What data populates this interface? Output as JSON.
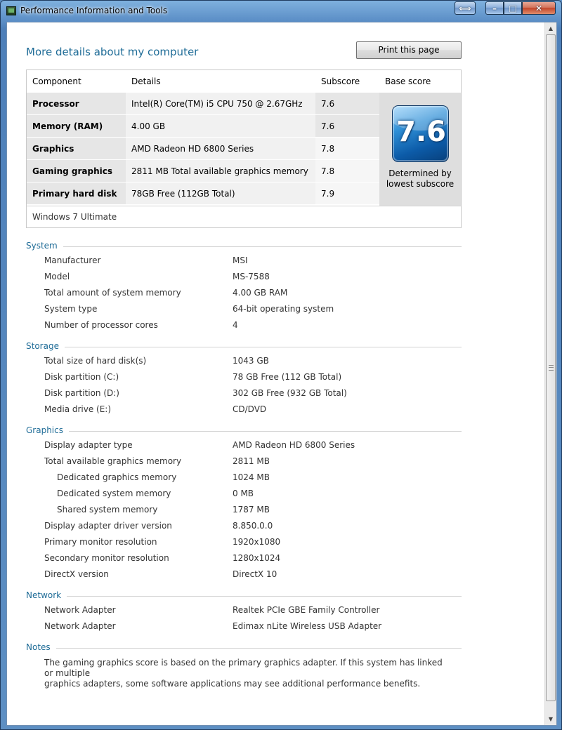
{
  "window": {
    "title": "Performance Information and Tools",
    "controls": {
      "resize": "⟺",
      "minimize": "–",
      "maximize": "□",
      "close": "✕"
    }
  },
  "page": {
    "title": "More details about my computer",
    "print_button": "Print this page"
  },
  "score_table": {
    "headers": [
      "Component",
      "Details",
      "Subscore",
      "Base score"
    ],
    "rows": [
      {
        "component": "Processor",
        "details": "Intel(R) Core(TM) i5 CPU 750 @ 2.67GHz",
        "subscore": "7.6"
      },
      {
        "component": "Memory (RAM)",
        "details": "4.00 GB",
        "subscore": "7.6"
      },
      {
        "component": "Graphics",
        "details": "AMD Radeon HD 6800 Series",
        "subscore": "7.8"
      },
      {
        "component": "Gaming graphics",
        "details": "2811 MB Total available graphics memory",
        "subscore": "7.8"
      },
      {
        "component": "Primary hard disk",
        "details": "78GB Free (112GB Total)",
        "subscore": "7.9"
      }
    ],
    "base_score": "7.6",
    "base_caption_line1": "Determined by",
    "base_caption_line2": "lowest subscore",
    "footer": "Windows 7 Ultimate"
  },
  "system": {
    "title": "System",
    "items": [
      {
        "key": "Manufacturer",
        "value": "MSI"
      },
      {
        "key": "Model",
        "value": "MS-7588"
      },
      {
        "key": "Total amount of system memory",
        "value": "4.00 GB RAM"
      },
      {
        "key": "System type",
        "value": "64-bit operating system"
      },
      {
        "key": "Number of processor cores",
        "value": "4"
      }
    ]
  },
  "storage": {
    "title": "Storage",
    "items": [
      {
        "key": "Total size of hard disk(s)",
        "value": "1043 GB"
      },
      {
        "key": "Disk partition (C:)",
        "value": "78 GB Free (112 GB Total)"
      },
      {
        "key": "Disk partition (D:)",
        "value": "302 GB Free (932 GB Total)"
      },
      {
        "key": "Media drive (E:)",
        "value": "CD/DVD"
      }
    ]
  },
  "graphics": {
    "title": "Graphics",
    "items": [
      {
        "key": "Display adapter type",
        "value": "AMD Radeon HD 6800 Series"
      },
      {
        "key": "Total available graphics memory",
        "value": "2811 MB"
      },
      {
        "key": "Dedicated graphics memory",
        "value": "1024 MB"
      },
      {
        "key": "Dedicated system memory",
        "value": "0 MB"
      },
      {
        "key": "Shared system memory",
        "value": "1787 MB"
      },
      {
        "key": "Display adapter driver version",
        "value": "8.850.0.0"
      },
      {
        "key": "Primary monitor resolution",
        "value": "1920x1080"
      },
      {
        "key": "Secondary monitor resolution",
        "value": "1280x1024"
      },
      {
        "key": "DirectX version",
        "value": "DirectX 10"
      }
    ]
  },
  "network": {
    "title": "Network",
    "items": [
      {
        "key": "Network Adapter",
        "value": "Realtek PCIe GBE Family Controller"
      },
      {
        "key": "Network Adapter",
        "value": "Edimax nLite Wireless USB Adapter"
      }
    ]
  },
  "notes": {
    "title": "Notes",
    "text_line1": "The gaming graphics score is based on the primary graphics adapter. If this system has linked or multiple",
    "text_line2": "graphics adapters, some software applications may see additional performance benefits."
  },
  "colors": {
    "accent": "#1f6c97",
    "frame": "#5d8fc3",
    "close": "#c2452a"
  },
  "icons": {
    "app": "performance-monitor-icon",
    "badge": "windows-experience-index-badge-icon"
  }
}
